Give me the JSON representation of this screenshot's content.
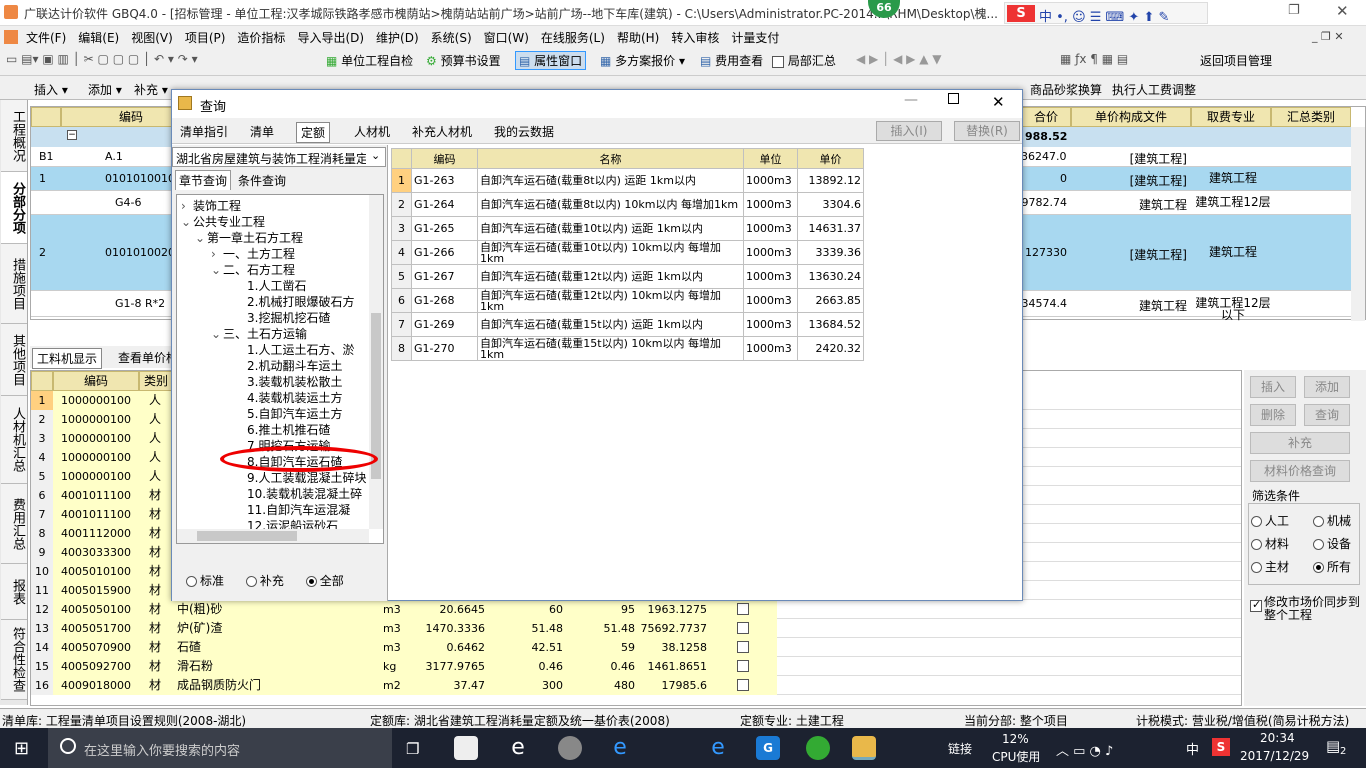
{
  "window": {
    "title": "广联达计价软件 GBQ4.0 - [招标管理 - 单位工程:汉孝城际铁路孝感市槐荫站>槐荫站站前广场>站前广场--地下车库(建筑) - C:\\Users\\Administrator.PC-2014...\\RHM\\Desktop\\槐...",
    "badge": "66"
  },
  "menu": [
    "文件(F)",
    "编辑(E)",
    "视图(V)",
    "项目(P)",
    "造价指标",
    "导入导出(D)",
    "维护(D)",
    "系统(S)",
    "窗口(W)",
    "在线服务(L)",
    "帮助(H)",
    "转入审核",
    "计量支付"
  ],
  "toolbar1": {
    "self_check": "单位工程自检",
    "budget_settings": "预算书设置",
    "attr_window": "属性窗口",
    "multi_quote": "多方案报价",
    "fee_view": "费用查看",
    "partial_sum": "局部汇总",
    "return_project": "返回项目管理"
  },
  "toolbar2": {
    "insert": "插入",
    "add": "添加",
    "supplement": "补充",
    "mix_conv": "商品砂浆换算",
    "labor_adj": "执行人工费调整"
  },
  "left_tabs": [
    "工程概况",
    "分部分项",
    "措施项目",
    "其他项目",
    "人材机汇总",
    "费用汇总",
    "报表",
    "符合性检查"
  ],
  "upper_grid": {
    "headers": {
      "code": "编码",
      "total_price": "合价",
      "unit_price_file": "单价构成文件",
      "fee_major": "取费专业",
      "summary_cat": "汇总类别"
    },
    "total": "988.52",
    "rows": [
      {
        "no": "B1",
        "code": "A.1",
        "total": "36247.05",
        "file": "[建筑工程]",
        "major": ""
      },
      {
        "no": "1",
        "code": "010101001001",
        "total": "0",
        "file": "[建筑工程]",
        "major": "建筑工程"
      },
      {
        "no": "",
        "code": "G4-6",
        "total": "9782.74",
        "file": "建筑工程",
        "major": "建筑工程12层"
      },
      {
        "no": "2",
        "code": "010101002001",
        "total": "127330",
        "file": "[建筑工程]",
        "major": "建筑工程"
      },
      {
        "no": "",
        "code": "G1-8 R*2",
        "total": "34574.4",
        "file": "建筑工程",
        "major": "建筑工程12层以下"
      }
    ]
  },
  "bottom_tabs": {
    "labor_display": "工料机显示",
    "view_unit": "查看单价构"
  },
  "bottom_grid": {
    "headers": {
      "code": "编码",
      "type": "类别"
    },
    "rows": [
      {
        "no": "1",
        "code": "1000000100",
        "type": "人"
      },
      {
        "no": "2",
        "code": "1000000100",
        "type": "人"
      },
      {
        "no": "3",
        "code": "1000000100",
        "type": "人"
      },
      {
        "no": "4",
        "code": "1000000100",
        "type": "人"
      },
      {
        "no": "5",
        "code": "1000000100",
        "type": "人"
      },
      {
        "no": "6",
        "code": "4001011100",
        "type": "材"
      },
      {
        "no": "7",
        "code": "4001011100",
        "type": "材"
      },
      {
        "no": "8",
        "code": "4001112000",
        "type": "材"
      },
      {
        "no": "9",
        "code": "4003033300",
        "type": "材"
      },
      {
        "no": "10",
        "code": "4005010100",
        "type": "材"
      },
      {
        "no": "11",
        "code": "4005015900",
        "type": "材"
      },
      {
        "no": "12",
        "code": "4005050100",
        "type": "材",
        "name": "中(粗)砂",
        "unit": "m3",
        "qty": "20.6645",
        "p1": "60",
        "p2": "95",
        "sum": "1963.1275"
      },
      {
        "no": "13",
        "code": "4005051700",
        "type": "材",
        "name": "炉(矿)渣",
        "unit": "m3",
        "qty": "1470.3336",
        "p1": "51.48",
        "p2": "51.48",
        "sum": "75692.7737"
      },
      {
        "no": "14",
        "code": "4005070900",
        "type": "材",
        "name": "石碴",
        "unit": "m3",
        "qty": "0.6462",
        "p1": "42.51",
        "p2": "59",
        "sum": "38.1258"
      },
      {
        "no": "15",
        "code": "4005092700",
        "type": "材",
        "name": "滑石粉",
        "unit": "kg",
        "qty": "3177.9765",
        "p1": "0.46",
        "p2": "0.46",
        "sum": "1461.8651"
      },
      {
        "no": "16",
        "code": "4009018000",
        "type": "材",
        "name": "成品钢质防火门",
        "unit": "m2",
        "qty": "37.47",
        "p1": "300",
        "p2": "480",
        "sum": "17985.6"
      }
    ]
  },
  "right_panel": {
    "insert": "插入",
    "add": "添加",
    "delete": "删除",
    "query": "查询",
    "supplement": "补充",
    "price_query": "材料价格查询",
    "filter_title": "筛选条件",
    "labor": "人工",
    "machine": "机械",
    "material": "材料",
    "equipment": "设备",
    "main_mat": "主材",
    "all": "所有",
    "sync_label": "修改市场价同步到整个工程"
  },
  "dialog": {
    "title": "查询",
    "tabs": [
      "清单指引",
      "清单",
      "定额",
      "人材机",
      "补充人材机",
      "我的云数据"
    ],
    "insert_btn": "插入(I)",
    "replace_btn": "替换(R)",
    "library": "湖北省房屋建筑与装饰工程消耗量定",
    "subtabs": [
      "章节查询",
      "条件查询"
    ],
    "tree": [
      "装饰工程",
      "公共专业工程",
      "第一章土石方工程",
      "一、土方工程",
      "二、石方工程",
      "1.人工凿石",
      "2.机械打眼爆破石方",
      "3.挖掘机挖石碴",
      "三、土石方运输",
      "1.人工运土石方、淤",
      "2.机动翻斗车运土",
      "3.装载机装松散土",
      "4.装载机装运土方",
      "5.自卸汽车运土方",
      "6.推土机推石碴",
      "7.明挖石方运输",
      "8.自卸汽车运石碴",
      "9.人工装载混凝土碎块",
      "10.装载机装混凝土碎",
      "11.自卸汽车运混凝",
      "12.运泥船运砂石",
      "四、回填及其他"
    ],
    "radios": [
      "标准",
      "补充",
      "全部"
    ],
    "table_headers": {
      "code": "编码",
      "name": "名称",
      "unit": "单位",
      "price": "单价"
    },
    "rows": [
      {
        "no": "1",
        "code": "G1-263",
        "name": "自卸汽车运石碴(载重8t以内) 运距 1km以内",
        "unit": "1000m3",
        "price": "13892.12"
      },
      {
        "no": "2",
        "code": "G1-264",
        "name": "自卸汽车运石碴(载重8t以内) 10km以内 每增加1km",
        "unit": "1000m3",
        "price": "3304.6"
      },
      {
        "no": "3",
        "code": "G1-265",
        "name": "自卸汽车运石碴(载重10t以内) 运距 1km以内",
        "unit": "1000m3",
        "price": "14631.37"
      },
      {
        "no": "4",
        "code": "G1-266",
        "name": "自卸汽车运石碴(载重10t以内) 10km以内 每增加1km",
        "unit": "1000m3",
        "price": "3339.36"
      },
      {
        "no": "5",
        "code": "G1-267",
        "name": "自卸汽车运石碴(载重12t以内) 运距 1km以内",
        "unit": "1000m3",
        "price": "13630.24"
      },
      {
        "no": "6",
        "code": "G1-268",
        "name": "自卸汽车运石碴(载重12t以内) 10km以内 每增加1km",
        "unit": "1000m3",
        "price": "2663.85"
      },
      {
        "no": "7",
        "code": "G1-269",
        "name": "自卸汽车运石碴(载重15t以内) 运距 1km以内",
        "unit": "1000m3",
        "price": "13684.52"
      },
      {
        "no": "8",
        "code": "G1-270",
        "name": "自卸汽车运石碴(载重15t以内) 10km以内 每增加1km",
        "unit": "1000m3",
        "price": "2420.32"
      }
    ]
  },
  "status": {
    "list_lib": "清单库: 工程量清单项目设置规则(2008-湖北)",
    "quota_lib": "定额库: 湖北省建筑工程消耗量定额及统一基价表(2008)",
    "quota_major": "定额专业: 土建工程",
    "current_part": "当前分部: 整个项目",
    "tax_mode": "计税模式: 营业税/增值税(简易计税方法)"
  },
  "taskbar": {
    "search": "在这里输入你要搜索的内容",
    "link": "链接",
    "cpu": "12%",
    "cpu_label": "CPU使用",
    "ime": "中",
    "time": "20:34",
    "date": "2017/12/29",
    "notif": "2"
  }
}
